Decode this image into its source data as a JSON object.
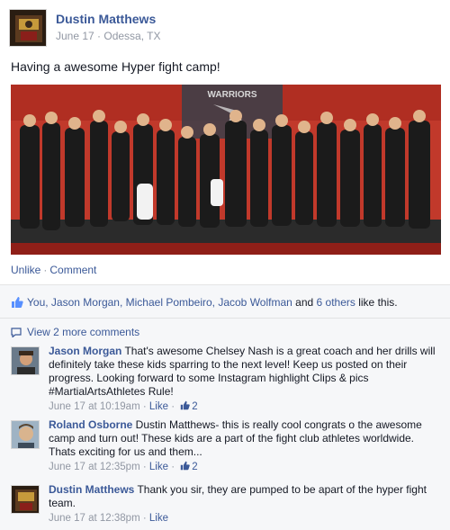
{
  "post": {
    "author": "Dustin Matthews",
    "date": "June 17",
    "location": "Odessa, TX",
    "meta_sep": " · ",
    "text": "Having a awesome Hyper fight camp!",
    "photo_banner": "WARRIORS"
  },
  "actions": {
    "unlike": "Unlike",
    "sep": "·",
    "comment": "Comment"
  },
  "likes": {
    "names": "You, Jason Morgan, Michael Pombeiro, Jacob Wolfman",
    "and": " and ",
    "others": "6 others",
    "suffix": " like this."
  },
  "view_more": "View 2 more comments",
  "comments": [
    {
      "author": "Jason Morgan",
      "text": " That's awesome Chelsey Nash is a great coach and her drills will definitely take these kids sparring to the next level! Keep us posted on their progress. Looking forward to some Instagram highlight Clips & pics #MartialArtsAthletes Rule!",
      "time": "June 17 at 10:19am",
      "like": "Like",
      "like_count": "2"
    },
    {
      "author": "Roland Osborne",
      "text": " Dustin Matthews- this is really cool congrats o the awesome camp and turn out! These kids are a part of the fight club athletes worldwide. Thats exciting for us and them...",
      "time": "June 17 at 12:35pm",
      "like": "Like",
      "like_count": "2"
    },
    {
      "author": "Dustin Matthews",
      "text": " Thank you sir, they are pumped to be apart of the hyper fight team.",
      "time": "June 17 at 12:38pm",
      "like": "Like",
      "like_count": ""
    }
  ],
  "colors": {
    "link": "#3b5998",
    "meta": "#9197a3",
    "photo_wall": "#c1392b",
    "feedback_bg": "#f6f7f9"
  }
}
